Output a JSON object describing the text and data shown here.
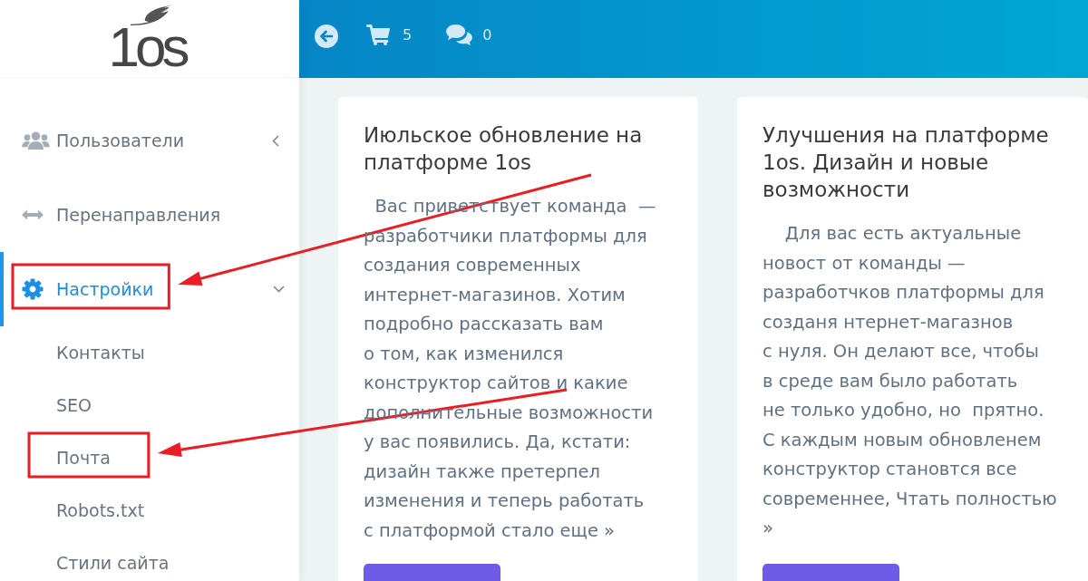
{
  "logo": {
    "text": "1os"
  },
  "header": {
    "cart_count": "5",
    "messages_count": "0"
  },
  "sidebar": {
    "items": [
      {
        "label": "Пользователи",
        "kind": "group",
        "expanded": false,
        "selected": false,
        "highlighted": false
      },
      {
        "label": "Перенаправления",
        "kind": "link",
        "selected": false,
        "highlighted": false
      },
      {
        "label": "Настройки",
        "kind": "group",
        "expanded": true,
        "selected": true,
        "highlighted": true,
        "children": [
          {
            "label": "Контакты",
            "selected": false,
            "highlighted": false
          },
          {
            "label": "SEO",
            "selected": false,
            "highlighted": false
          },
          {
            "label": "Почта",
            "selected": false,
            "highlighted": true
          },
          {
            "label": "Robots.txt",
            "selected": false,
            "highlighted": false
          },
          {
            "label": "Стили сайта",
            "selected": false,
            "highlighted": false
          }
        ]
      }
    ]
  },
  "cards": [
    {
      "title": "Июльское обновление на\nплатформе 1os",
      "text": "  Вас приветствует команда  —\nразработчики платформы для\nсоздания современных\nинтернет-магазинов. Хотим\nподробно рассказать вам\nо том, как изменился\nконструктор сайтов и какие\nдополнительные возможности\nу вас появились. Да, кстати:\nдизайн также претерпел\nизменения и теперь работать\nс платформой стало еще »"
    },
    {
      "title": "Улучшения на платформе\n1os. Дизайн и новые\nвозможности",
      "text": "    Для вас есть актуальные\nновост от команды —\nразработчков платформы для\nсозданя нтернет-магазнов\nс нуля. Он делают все, чтобы\nв среде вам было работать\nне только удобно, но  прятно.\nС каждым новым обновленем\nконструктор становтся все\nсовременнее, Чтать полностью\n»"
    }
  ]
}
